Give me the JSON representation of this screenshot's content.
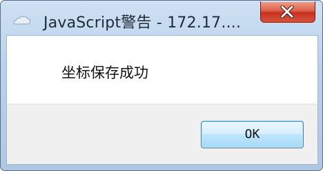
{
  "window": {
    "title": "JavaScript警告 - 172.17....",
    "close_icon": "close-icon",
    "app_icon": "javascript-cloud-icon"
  },
  "dialog": {
    "message": "坐标保存成功",
    "ok_label": "OK"
  },
  "colors": {
    "title_bar": "#b9d1ea",
    "close_button": "#d6543e",
    "ok_button": "#bee6fd",
    "footer": "#f0f0f0"
  }
}
